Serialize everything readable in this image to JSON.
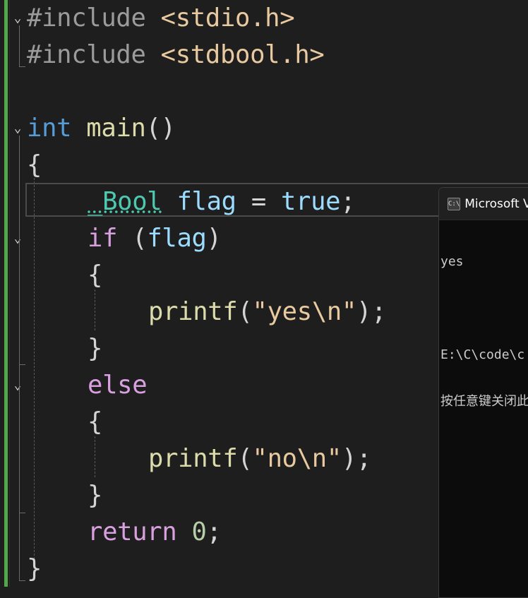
{
  "editor": {
    "lines": [
      {
        "pp": "#include",
        "header": " <stdio.h>"
      },
      {
        "pp": "#include",
        "header": " <stdbool.h>"
      },
      {},
      {
        "kw": "int",
        "fn": "main",
        "punct": "()"
      },
      {
        "brace": "{"
      },
      {
        "type": "_Bool",
        "var": "flag",
        "op": " = ",
        "value": "true",
        "end": ";"
      },
      {
        "kw": "if",
        "open": " (",
        "var": "flag",
        "close": ")"
      },
      {
        "brace": "{"
      },
      {
        "fn": "printf",
        "open": "(",
        "str_open": "\"yes",
        "esc": "\\n",
        "str_close": "\"",
        "end": ");"
      },
      {
        "brace": "}"
      },
      {
        "kw": "else"
      },
      {
        "brace": "{"
      },
      {
        "fn": "printf",
        "open": "(",
        "str_open": "\"no",
        "esc": "\\n",
        "str_close": "\"",
        "end": ");"
      },
      {
        "brace": "}"
      },
      {
        "kw": "return",
        "space": " ",
        "num": "0",
        "end": ";"
      },
      {
        "brace": "}"
      }
    ],
    "fold_glyph": "⌄",
    "colors": {
      "background": "#1e1e1e",
      "change_bar": "#4fa84a",
      "keyword": "#569cd6",
      "control": "#d8a0df",
      "function": "#dcdcaa",
      "variable": "#9cdcfe",
      "type": "#4ec9b0",
      "string": "#e8c9a0",
      "number": "#b5cea8"
    }
  },
  "console": {
    "title": "Microsoft Visual Studio Debug Console",
    "icon_text": "C:\\",
    "icon": "terminal-icon",
    "lines": [
      "yes",
      "",
      "E:\\C\\code\\c",
      "按任意键关闭此窗口"
    ]
  }
}
